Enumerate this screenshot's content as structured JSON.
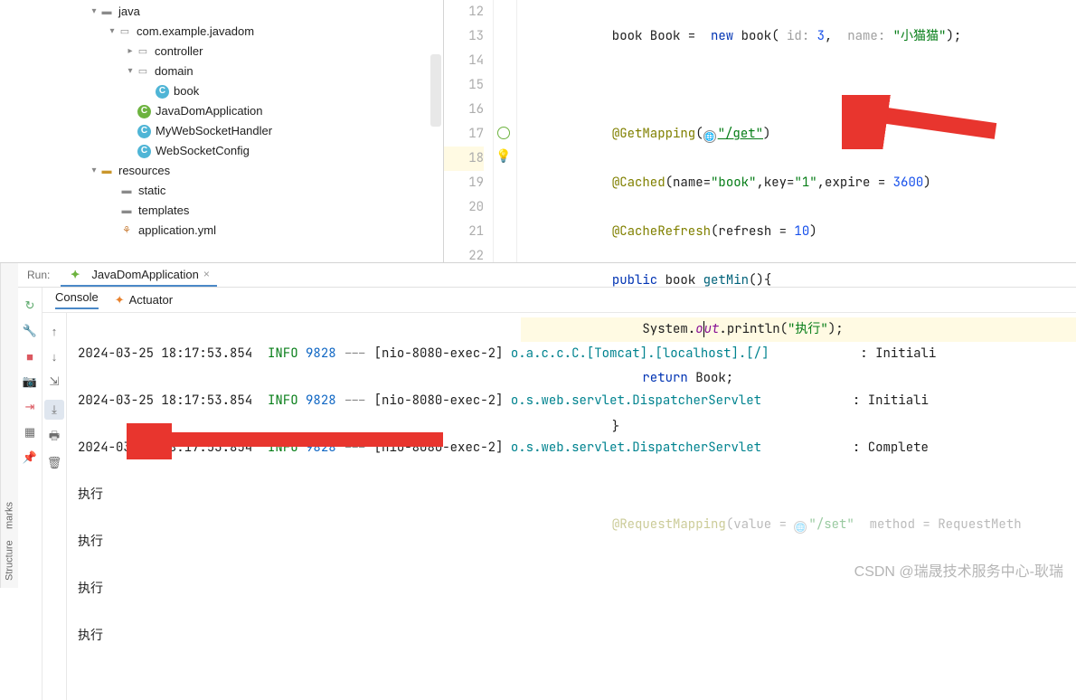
{
  "tree": {
    "java": "java",
    "pkg": "com.example.javadom",
    "controller": "controller",
    "domain": "domain",
    "book": "book",
    "app": "JavaDomApplication",
    "ws": "MyWebSocketHandler",
    "wscfg": "WebSocketConfig",
    "resources": "resources",
    "static": "static",
    "templates": "templates",
    "yml": "application.yml"
  },
  "editor": {
    "line12": "            book Book =  new book( id: 3,  name: \"小猫猫\");",
    "line13": "",
    "line14_a": "            @GetMapping(",
    "line14_b": "\"/get\"",
    "line14_c": ")",
    "line15": "            @Cached(name=\"book\",key=\"1\",expire = 3600)",
    "line16": "            @CacheRefresh(refresh = 10)",
    "line17": "            public book getMin(){",
    "line18": "                System.out.println(\"执行\");",
    "line19": "                return Book;",
    "line20": "            }",
    "line21": "",
    "line22": "            @RequestMapping(value = \"/set\"  method = RequestMeth"
  },
  "gutter": [
    "12",
    "13",
    "14",
    "15",
    "16",
    "17",
    "18",
    "19",
    "20",
    "21",
    "22"
  ],
  "run": {
    "label": "Run:",
    "tab": "JavaDomApplication",
    "console_tab": "Console",
    "actuator_tab": "Actuator",
    "logs": [
      {
        "ts": "2024-03-25 18:17:53.854",
        "lvl": "INFO",
        "pid": "9828",
        "thread": "[nio-8080-exec-2]",
        "logger": "o.a.c.c.C.[Tomcat].[localhost].[/]",
        "msg": ": Initiali"
      },
      {
        "ts": "2024-03-25 18:17:53.854",
        "lvl": "INFO",
        "pid": "9828",
        "thread": "[nio-8080-exec-2]",
        "logger": "o.s.web.servlet.DispatcherServlet",
        "msg": ": Initiali"
      },
      {
        "ts": "2024-03-25 18:17:53.854",
        "lvl": "INFO",
        "pid": "9828",
        "thread": "[nio-8080-exec-2]",
        "logger": "o.s.web.servlet.DispatcherServlet",
        "msg": ": Complete"
      }
    ],
    "out": [
      "执行",
      "执行",
      "执行",
      "执行"
    ]
  },
  "sidepanel": {
    "structure": "Structure",
    "bookmarks": "marks"
  },
  "watermark": "CSDN @瑞晟技术服务中心-耿瑞"
}
